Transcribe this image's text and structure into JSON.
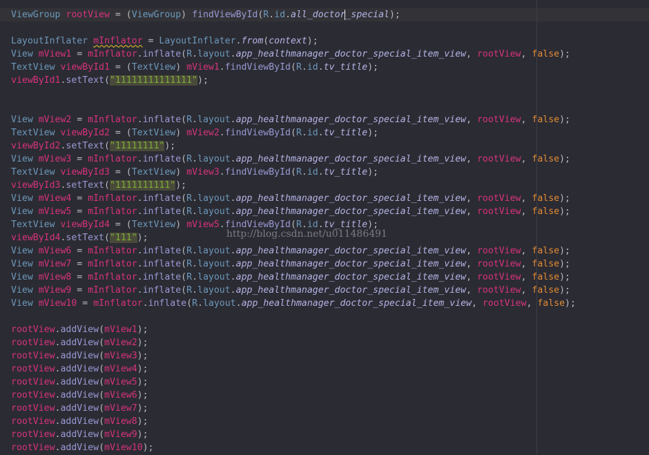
{
  "watermark": "http://blog.csdn.net/u011486491",
  "colors": {
    "background": "#2b2b33",
    "type": "#6c99bb",
    "variable": "#d7337c",
    "method": "#9a9ad6",
    "italic_member": "#b4b4e6",
    "keyword": "#e38c35",
    "string": "#7dae37"
  },
  "lines": [
    [
      [
        "t",
        "ViewGroup "
      ],
      [
        "v",
        "rootView"
      ],
      [
        "p",
        " = ("
      ],
      [
        "t",
        "ViewGroup"
      ],
      [
        "p",
        ") "
      ],
      [
        "m",
        "findViewById"
      ],
      [
        "p",
        "("
      ],
      [
        "t",
        "R"
      ],
      [
        "p",
        "."
      ],
      [
        "t",
        "id"
      ],
      [
        "p",
        "."
      ],
      [
        "i",
        "all_doctor"
      ],
      [
        "c",
        "_special"
      ],
      [
        "p",
        ");"
      ]
    ],
    [],
    [
      [
        "t",
        "LayoutInflater "
      ],
      [
        "v",
        "mInflator"
      ],
      [
        "p",
        " = "
      ],
      [
        "t",
        "LayoutInflater"
      ],
      [
        "p",
        "."
      ],
      [
        "i",
        "from"
      ],
      [
        "p",
        "("
      ],
      [
        "i",
        "context"
      ],
      [
        "p",
        ");"
      ]
    ],
    [
      [
        "t",
        "View "
      ],
      [
        "v",
        "mView1"
      ],
      [
        "p",
        " = "
      ],
      [
        "v",
        "mInflator"
      ],
      [
        "p",
        "."
      ],
      [
        "m",
        "inflate"
      ],
      [
        "p",
        "("
      ],
      [
        "t",
        "R"
      ],
      [
        "p",
        "."
      ],
      [
        "t",
        "layout"
      ],
      [
        "p",
        "."
      ],
      [
        "i",
        "app_healthmanager_doctor_special_item_view"
      ],
      [
        "p",
        ", "
      ],
      [
        "v",
        "rootView"
      ],
      [
        "p",
        ", "
      ],
      [
        "k",
        "false"
      ],
      [
        "p",
        ");"
      ]
    ],
    [
      [
        "t",
        "TextView "
      ],
      [
        "v",
        "viewById1"
      ],
      [
        "p",
        " = ("
      ],
      [
        "t",
        "TextView"
      ],
      [
        "p",
        ") "
      ],
      [
        "v",
        "mView1"
      ],
      [
        "p",
        "."
      ],
      [
        "m",
        "findViewById"
      ],
      [
        "p",
        "("
      ],
      [
        "t",
        "R"
      ],
      [
        "p",
        "."
      ],
      [
        "t",
        "id"
      ],
      [
        "p",
        "."
      ],
      [
        "i",
        "tv_title"
      ],
      [
        "p",
        ");"
      ]
    ],
    [
      [
        "v",
        "viewById1"
      ],
      [
        "p",
        "."
      ],
      [
        "m",
        "setText"
      ],
      [
        "p",
        "("
      ],
      [
        "s",
        "\"11111111111111\""
      ],
      [
        "p",
        ");"
      ]
    ],
    [],
    [],
    [
      [
        "t",
        "View "
      ],
      [
        "v",
        "mView2"
      ],
      [
        "p",
        " = "
      ],
      [
        "v",
        "mInflator"
      ],
      [
        "p",
        "."
      ],
      [
        "m",
        "inflate"
      ],
      [
        "p",
        "("
      ],
      [
        "t",
        "R"
      ],
      [
        "p",
        "."
      ],
      [
        "t",
        "layout"
      ],
      [
        "p",
        "."
      ],
      [
        "i",
        "app_healthmanager_doctor_special_item_view"
      ],
      [
        "p",
        ", "
      ],
      [
        "v",
        "rootView"
      ],
      [
        "p",
        ", "
      ],
      [
        "k",
        "false"
      ],
      [
        "p",
        ");"
      ]
    ],
    [
      [
        "t",
        "TextView "
      ],
      [
        "v",
        "viewById2"
      ],
      [
        "p",
        " = ("
      ],
      [
        "t",
        "TextView"
      ],
      [
        "p",
        ") "
      ],
      [
        "v",
        "mView2"
      ],
      [
        "p",
        "."
      ],
      [
        "m",
        "findViewById"
      ],
      [
        "p",
        "("
      ],
      [
        "t",
        "R"
      ],
      [
        "p",
        "."
      ],
      [
        "t",
        "id"
      ],
      [
        "p",
        "."
      ],
      [
        "i",
        "tv_title"
      ],
      [
        "p",
        ");"
      ]
    ],
    [
      [
        "v",
        "viewById2"
      ],
      [
        "p",
        "."
      ],
      [
        "m",
        "setText"
      ],
      [
        "p",
        "("
      ],
      [
        "s",
        "\"11111111\""
      ],
      [
        "p",
        ");"
      ]
    ],
    [
      [
        "t",
        "View "
      ],
      [
        "v",
        "mView3"
      ],
      [
        "p",
        " = "
      ],
      [
        "v",
        "mInflator"
      ],
      [
        "p",
        "."
      ],
      [
        "m",
        "inflate"
      ],
      [
        "p",
        "("
      ],
      [
        "t",
        "R"
      ],
      [
        "p",
        "."
      ],
      [
        "t",
        "layout"
      ],
      [
        "p",
        "."
      ],
      [
        "i",
        "app_healthmanager_doctor_special_item_view"
      ],
      [
        "p",
        ", "
      ],
      [
        "v",
        "rootView"
      ],
      [
        "p",
        ", "
      ],
      [
        "k",
        "false"
      ],
      [
        "p",
        ");"
      ]
    ],
    [
      [
        "t",
        "TextView "
      ],
      [
        "v",
        "viewById3"
      ],
      [
        "p",
        " = ("
      ],
      [
        "t",
        "TextView"
      ],
      [
        "p",
        ") "
      ],
      [
        "v",
        "mView3"
      ],
      [
        "p",
        "."
      ],
      [
        "m",
        "findViewById"
      ],
      [
        "p",
        "("
      ],
      [
        "t",
        "R"
      ],
      [
        "p",
        "."
      ],
      [
        "t",
        "id"
      ],
      [
        "p",
        "."
      ],
      [
        "i",
        "tv_title"
      ],
      [
        "p",
        ");"
      ]
    ],
    [
      [
        "v",
        "viewById3"
      ],
      [
        "p",
        "."
      ],
      [
        "m",
        "setText"
      ],
      [
        "p",
        "("
      ],
      [
        "s",
        "\"1111111111\""
      ],
      [
        "p",
        ");"
      ]
    ],
    [
      [
        "t",
        "View "
      ],
      [
        "v",
        "mView4"
      ],
      [
        "p",
        " = "
      ],
      [
        "v",
        "mInflator"
      ],
      [
        "p",
        "."
      ],
      [
        "m",
        "inflate"
      ],
      [
        "p",
        "("
      ],
      [
        "t",
        "R"
      ],
      [
        "p",
        "."
      ],
      [
        "t",
        "layout"
      ],
      [
        "p",
        "."
      ],
      [
        "i",
        "app_healthmanager_doctor_special_item_view"
      ],
      [
        "p",
        ", "
      ],
      [
        "v",
        "rootView"
      ],
      [
        "p",
        ", "
      ],
      [
        "k",
        "false"
      ],
      [
        "p",
        ");"
      ]
    ],
    [
      [
        "t",
        "View "
      ],
      [
        "v",
        "mView5"
      ],
      [
        "p",
        " = "
      ],
      [
        "v",
        "mInflator"
      ],
      [
        "p",
        "."
      ],
      [
        "m",
        "inflate"
      ],
      [
        "p",
        "("
      ],
      [
        "t",
        "R"
      ],
      [
        "p",
        "."
      ],
      [
        "t",
        "layout"
      ],
      [
        "p",
        "."
      ],
      [
        "i",
        "app_healthmanager_doctor_special_item_view"
      ],
      [
        "p",
        ", "
      ],
      [
        "v",
        "rootView"
      ],
      [
        "p",
        ", "
      ],
      [
        "k",
        "false"
      ],
      [
        "p",
        ");"
      ]
    ],
    [
      [
        "t",
        "TextView "
      ],
      [
        "v",
        "viewById4"
      ],
      [
        "p",
        " = ("
      ],
      [
        "t",
        "TextView"
      ],
      [
        "p",
        ") "
      ],
      [
        "v",
        "mView5"
      ],
      [
        "p",
        "."
      ],
      [
        "m",
        "findViewById"
      ],
      [
        "p",
        "("
      ],
      [
        "t",
        "R"
      ],
      [
        "p",
        "."
      ],
      [
        "t",
        "id"
      ],
      [
        "p",
        "."
      ],
      [
        "i",
        "tv_title"
      ],
      [
        "p",
        ");"
      ]
    ],
    [
      [
        "v",
        "viewById4"
      ],
      [
        "p",
        "."
      ],
      [
        "m",
        "setText"
      ],
      [
        "p",
        "("
      ],
      [
        "s",
        "\"111\""
      ],
      [
        "p",
        ");"
      ]
    ],
    [
      [
        "t",
        "View "
      ],
      [
        "v",
        "mView6"
      ],
      [
        "p",
        " = "
      ],
      [
        "v",
        "mInflator"
      ],
      [
        "p",
        "."
      ],
      [
        "m",
        "inflate"
      ],
      [
        "p",
        "("
      ],
      [
        "t",
        "R"
      ],
      [
        "p",
        "."
      ],
      [
        "t",
        "layout"
      ],
      [
        "p",
        "."
      ],
      [
        "i",
        "app_healthmanager_doctor_special_item_view"
      ],
      [
        "p",
        ", "
      ],
      [
        "v",
        "rootView"
      ],
      [
        "p",
        ", "
      ],
      [
        "k",
        "false"
      ],
      [
        "p",
        ");"
      ]
    ],
    [
      [
        "t",
        "View "
      ],
      [
        "v",
        "mView7"
      ],
      [
        "p",
        " = "
      ],
      [
        "v",
        "mInflator"
      ],
      [
        "p",
        "."
      ],
      [
        "m",
        "inflate"
      ],
      [
        "p",
        "("
      ],
      [
        "t",
        "R"
      ],
      [
        "p",
        "."
      ],
      [
        "t",
        "layout"
      ],
      [
        "p",
        "."
      ],
      [
        "i",
        "app_healthmanager_doctor_special_item_view"
      ],
      [
        "p",
        ", "
      ],
      [
        "v",
        "rootView"
      ],
      [
        "p",
        ", "
      ],
      [
        "k",
        "false"
      ],
      [
        "p",
        ");"
      ]
    ],
    [
      [
        "t",
        "View "
      ],
      [
        "v",
        "mView8"
      ],
      [
        "p",
        " = "
      ],
      [
        "v",
        "mInflator"
      ],
      [
        "p",
        "."
      ],
      [
        "m",
        "inflate"
      ],
      [
        "p",
        "("
      ],
      [
        "t",
        "R"
      ],
      [
        "p",
        "."
      ],
      [
        "t",
        "layout"
      ],
      [
        "p",
        "."
      ],
      [
        "i",
        "app_healthmanager_doctor_special_item_view"
      ],
      [
        "p",
        ", "
      ],
      [
        "v",
        "rootView"
      ],
      [
        "p",
        ", "
      ],
      [
        "k",
        "false"
      ],
      [
        "p",
        ");"
      ]
    ],
    [
      [
        "t",
        "View "
      ],
      [
        "v",
        "mView9"
      ],
      [
        "p",
        " = "
      ],
      [
        "v",
        "mInflator"
      ],
      [
        "p",
        "."
      ],
      [
        "m",
        "inflate"
      ],
      [
        "p",
        "("
      ],
      [
        "t",
        "R"
      ],
      [
        "p",
        "."
      ],
      [
        "t",
        "layout"
      ],
      [
        "p",
        "."
      ],
      [
        "i",
        "app_healthmanager_doctor_special_item_view"
      ],
      [
        "p",
        ", "
      ],
      [
        "v",
        "rootView"
      ],
      [
        "p",
        ", "
      ],
      [
        "k",
        "false"
      ],
      [
        "p",
        ");"
      ]
    ],
    [
      [
        "t",
        "View "
      ],
      [
        "v",
        "mView10"
      ],
      [
        "p",
        " = "
      ],
      [
        "v",
        "mInflator"
      ],
      [
        "p",
        "."
      ],
      [
        "m",
        "inflate"
      ],
      [
        "p",
        "("
      ],
      [
        "t",
        "R"
      ],
      [
        "p",
        "."
      ],
      [
        "t",
        "layout"
      ],
      [
        "p",
        "."
      ],
      [
        "i",
        "app_healthmanager_doctor_special_item_view"
      ],
      [
        "p",
        ", "
      ],
      [
        "v",
        "rootView"
      ],
      [
        "p",
        ", "
      ],
      [
        "k",
        "false"
      ],
      [
        "p",
        ");"
      ]
    ],
    [],
    [
      [
        "v",
        "rootView"
      ],
      [
        "p",
        "."
      ],
      [
        "m",
        "addView"
      ],
      [
        "p",
        "("
      ],
      [
        "v",
        "mView1"
      ],
      [
        "p",
        ");"
      ]
    ],
    [
      [
        "v",
        "rootView"
      ],
      [
        "p",
        "."
      ],
      [
        "m",
        "addView"
      ],
      [
        "p",
        "("
      ],
      [
        "v",
        "mView2"
      ],
      [
        "p",
        ");"
      ]
    ],
    [
      [
        "v",
        "rootView"
      ],
      [
        "p",
        "."
      ],
      [
        "m",
        "addView"
      ],
      [
        "p",
        "("
      ],
      [
        "v",
        "mView3"
      ],
      [
        "p",
        ");"
      ]
    ],
    [
      [
        "v",
        "rootView"
      ],
      [
        "p",
        "."
      ],
      [
        "m",
        "addView"
      ],
      [
        "p",
        "("
      ],
      [
        "v",
        "mView4"
      ],
      [
        "p",
        ");"
      ]
    ],
    [
      [
        "v",
        "rootView"
      ],
      [
        "p",
        "."
      ],
      [
        "m",
        "addView"
      ],
      [
        "p",
        "("
      ],
      [
        "v",
        "mView5"
      ],
      [
        "p",
        ");"
      ]
    ],
    [
      [
        "v",
        "rootView"
      ],
      [
        "p",
        "."
      ],
      [
        "m",
        "addView"
      ],
      [
        "p",
        "("
      ],
      [
        "v",
        "mView6"
      ],
      [
        "p",
        ");"
      ]
    ],
    [
      [
        "v",
        "rootView"
      ],
      [
        "p",
        "."
      ],
      [
        "m",
        "addView"
      ],
      [
        "p",
        "("
      ],
      [
        "v",
        "mView7"
      ],
      [
        "p",
        ");"
      ]
    ],
    [
      [
        "v",
        "rootView"
      ],
      [
        "p",
        "."
      ],
      [
        "m",
        "addView"
      ],
      [
        "p",
        "("
      ],
      [
        "v",
        "mView8"
      ],
      [
        "p",
        ");"
      ]
    ],
    [
      [
        "v",
        "rootView"
      ],
      [
        "p",
        "."
      ],
      [
        "m",
        "addView"
      ],
      [
        "p",
        "("
      ],
      [
        "v",
        "mView9"
      ],
      [
        "p",
        ");"
      ]
    ],
    [
      [
        "v",
        "rootView"
      ],
      [
        "p",
        "."
      ],
      [
        "m",
        "addView"
      ],
      [
        "p",
        "("
      ],
      [
        "v",
        "mView10"
      ],
      [
        "p",
        ");"
      ]
    ]
  ]
}
